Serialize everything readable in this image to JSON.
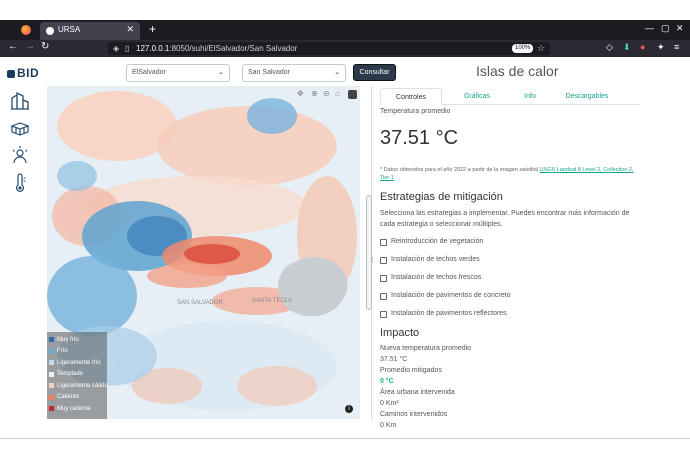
{
  "browser": {
    "tab_title": "URSA",
    "tab_close": "✕",
    "new_tab": "+",
    "url_host": "127.0.0.1",
    "url_rest": ":8050/suhi/ElSalvador/San Salvador",
    "zoom": "100%",
    "window_controls": [
      "—",
      "▢",
      "✕"
    ]
  },
  "header": {
    "logo": "BID",
    "country_select": "ElSalvador",
    "city_select": "San Salvador",
    "consult_button": "Consultar",
    "title": "Islas de calor"
  },
  "sidebar_icons": [
    "city-buildings-icon",
    "bricks-icon",
    "heat-person-icon",
    "thermometer-icon"
  ],
  "map": {
    "legend": [
      {
        "label": "Muy frío",
        "color": "#2b6aa8"
      },
      {
        "label": "Frío",
        "color": "#6aaed6"
      },
      {
        "label": "Ligeramente frío",
        "color": "#c6dcef"
      },
      {
        "label": "Templado",
        "color": "#f2f2f2"
      },
      {
        "label": "Ligeramente cálido",
        "color": "#fbd0b8"
      },
      {
        "label": "Caliente",
        "color": "#f07e5f"
      },
      {
        "label": "Muy caliente",
        "color": "#c22a2a"
      }
    ],
    "city_label": "SANTA TECLA",
    "city_label2": "SAN SALVADOR",
    "info": "i"
  },
  "panel": {
    "tabs": [
      "Controles",
      "Gráficas",
      "Info",
      "Descargables"
    ],
    "avg_temp_label": "Temperatura promedio",
    "avg_temp_value": "37.51 °C",
    "note_prefix": "* Datos obtenidos para el año 2022 a partir de la imagen satelital ",
    "note_link": "USGS Landsat 8 Level 2, Collection 2, Tier 1",
    "mitigation_title": "Estrategias de mitigación",
    "mitigation_desc": "Selecciona las estrategias a implementar. Puedes encontrar más información de cada estrategia o seleccionar múltiples.",
    "strategies": [
      "Reintroducción de vegetación",
      "Instalación de techos verdes",
      "Instalación de techos frescos",
      "Instalación de pavimentos de concreto",
      "Instalación de pavimentos reflectores"
    ],
    "impact_title": "Impacto",
    "new_temp_label": "Nueva temperatura promedio",
    "new_temp_value": "37.51 °C",
    "mitigated_label": "Promedio mitigados",
    "mitigated_value": "0 °C",
    "urban_area_label": "Área urbana intervenida",
    "urban_area_value": "0 Km²",
    "roads_label": "Caminos intervenidos",
    "roads_value": "0 Km"
  }
}
